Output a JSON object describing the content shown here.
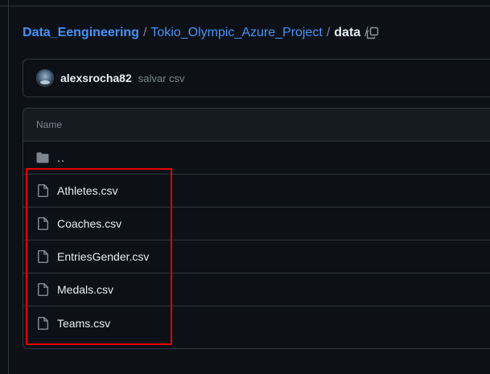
{
  "breadcrumb": {
    "root": "Data_Eengineering",
    "separator": "/",
    "project": "Tokio_Olympic_Azure_Project",
    "current": "data"
  },
  "commit": {
    "author": "alexsrocha82",
    "message": "salvar csv"
  },
  "table": {
    "header": "Name",
    "parent_dir": "..",
    "files": [
      {
        "name": "Athletes.csv",
        "icon": "file-icon"
      },
      {
        "name": "Coaches.csv",
        "icon": "file-icon"
      },
      {
        "name": "EntriesGender.csv",
        "icon": "file-icon"
      },
      {
        "name": "Medals.csv",
        "icon": "file-icon"
      },
      {
        "name": "Teams.csv",
        "icon": "file-icon"
      }
    ]
  },
  "icons": {
    "copy": "copy-icon",
    "folder": "folder-icon",
    "file": "file-icon"
  },
  "colors": {
    "background": "#0d1117",
    "link": "#4493f8",
    "text": "#e6edf3",
    "muted": "#7d8590",
    "border": "#30363d",
    "highlight": "#e60000"
  }
}
